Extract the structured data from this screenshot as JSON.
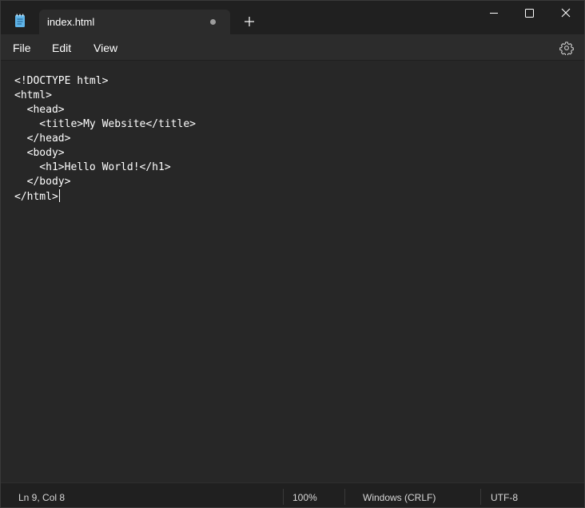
{
  "tab": {
    "title": "index.html"
  },
  "menu": {
    "file": "File",
    "edit": "Edit",
    "view": "View"
  },
  "editor": {
    "lines": [
      "<!DOCTYPE html>",
      "<html>",
      "  <head>",
      "    <title>My Website</title>",
      "  </head>",
      "  <body>",
      "    <h1>Hello World!</h1>",
      "  </body>",
      "</html>"
    ]
  },
  "status": {
    "position": "Ln 9, Col 8",
    "zoom": "100%",
    "line_ending": "Windows (CRLF)",
    "encoding": "UTF-8"
  },
  "icons": {
    "app": "notepad-icon",
    "new_tab": "plus-icon",
    "minimize": "minimize-icon",
    "maximize": "maximize-icon",
    "close": "close-icon",
    "settings": "gear-icon",
    "unsaved": "unsaved-dot-icon"
  }
}
